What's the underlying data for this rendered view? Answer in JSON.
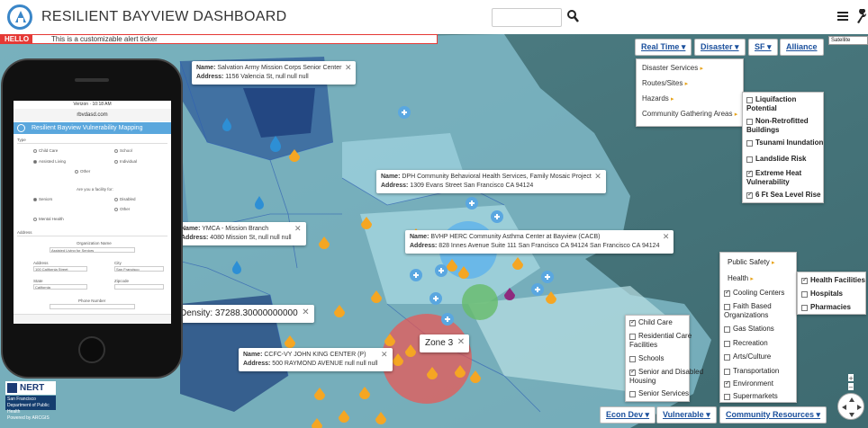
{
  "header": {
    "title": "RESILIENT BAYVIEW DASHBOARD",
    "search_placeholder": ""
  },
  "icons": {
    "logo": "logo-icon",
    "search": "search-icon",
    "menu": "menu-icon",
    "tools": "wrench-icon",
    "marker_water": "water-drop-icon",
    "marker_health": "health-cross-icon",
    "marker_people": "people-icon"
  },
  "colors": {
    "ticker_red": "#e53935",
    "link_blue": "#1a4f9c",
    "zone_red": "#ef5350",
    "buffer_green": "#66bb6a",
    "buffer_blue": "#42a5f5",
    "marker_orange": "#f5a623",
    "marker_blue": "#2d8fd5",
    "marker_purple": "#8e2a7e",
    "choropleth_dark": "#1b3d7a"
  },
  "ticker": {
    "label": "HELLO",
    "text": "This is a customizable alert ticker"
  },
  "popups": [
    {
      "name_label": "Name:",
      "name": "Salvation Army Mission Corps Senior Center",
      "address_label": "Address:",
      "address": "1156 Valencia St, null null null"
    },
    {
      "name_label": "Name:",
      "name": "DPH Community Behavioral Health Services, Family Mosaic Project",
      "address_label": "Address:",
      "address": "1309 Evans Street San Francisco CA 94124"
    },
    {
      "name_label": "Name:",
      "name": "YMCA - Mission Branch",
      "address_label": "Address:",
      "address": "4080 Mission St, null null null"
    },
    {
      "name_label": "Name:",
      "name": "BVHP HERC Community Asthma Center at Bayview (CACB)",
      "address_label": "Address:",
      "address": "828 Innes Avenue Suite 111 San Francisco CA 94124 San Francisco CA 94124"
    },
    {
      "name_label": "Name:",
      "name": "CCFC-VY JOHN KING CENTER (P)",
      "address_label": "Address:",
      "address": "500 RAYMOND AVENUE null null null"
    }
  ],
  "density_popup": {
    "text": "Density: 37288.30000000000"
  },
  "zone_popup": {
    "text": "Zone 3"
  },
  "map_buttons": {
    "real_time": "Real Time",
    "disaster": "Disaster",
    "sf": "SF",
    "alliance": "Alliance",
    "satellite": "Satellite",
    "econ_dev": "Econ Dev",
    "vulnerable": "Vulnerable",
    "community_resources": "Community Resources"
  },
  "disaster_menu": {
    "items": [
      "Disaster Services",
      "Routes/Sites",
      "Hazards",
      "Community Gathering Areas"
    ]
  },
  "hazard_layers": [
    {
      "label": "Liquifaction",
      "label2": "Potential",
      "checked": false
    },
    {
      "label": "Non-Retrofitted",
      "label2": "Buildings",
      "checked": false
    },
    {
      "label": "Tsunami Inundation",
      "checked": false
    },
    {
      "label": "Landslide Risk",
      "checked": false
    },
    {
      "label": "Extreme Heat",
      "label2": "Vulnerability",
      "checked": true
    },
    {
      "label": "6 Ft Sea Level Rise",
      "checked": true
    }
  ],
  "community_menu": {
    "items": [
      {
        "label": "Public Safety",
        "checked": null
      },
      {
        "label": "Health",
        "checked": null
      },
      {
        "label": "Cooling Centers",
        "checked": true
      },
      {
        "label": "Faith Based",
        "label2": "Organizations",
        "checked": false
      },
      {
        "label": "Gas Stations",
        "checked": false
      },
      {
        "label": "Recreation",
        "checked": false
      },
      {
        "label": "Arts/Culture",
        "checked": false
      },
      {
        "label": "Transportation",
        "checked": false
      },
      {
        "label": "Environment",
        "checked": true
      },
      {
        "label": "Supermarkets",
        "checked": false
      }
    ]
  },
  "health_menu": {
    "items": [
      {
        "label": "Health Facilities",
        "checked": true
      },
      {
        "label": "Hospitals",
        "checked": false
      },
      {
        "label": "Pharmacies",
        "checked": false
      }
    ]
  },
  "vulnerable_menu": {
    "items": [
      {
        "label": "Child Care",
        "checked": true
      },
      {
        "label": "Residential Care",
        "label2": "Facilities",
        "checked": false
      },
      {
        "label": "Schools",
        "checked": false
      },
      {
        "label": "Senior and Disabled",
        "label2": "Housing",
        "checked": true
      },
      {
        "label": "Senior Services",
        "checked": false
      }
    ]
  },
  "phone": {
    "status": "Verizon",
    "time": "10:18 AM",
    "url": "rbvdasd.com",
    "app_title": "Resilient Bayview Vulnerability Mapping",
    "section_type": "Type",
    "type_options": [
      "Child Care",
      "School",
      "Assisted Living",
      "Individual",
      "Other"
    ],
    "question": "Are you a facility for:",
    "facility_options": [
      "Seniors",
      "Disabled",
      "Other",
      "Mental Health"
    ],
    "section_address": "Address",
    "org_name_label": "Organization Name",
    "org_name_value": "Assisted Living for Seniors",
    "address_label": "Address",
    "address_value": "100 California Street",
    "city_label": "City",
    "city_value": "San Francisco",
    "state_label": "State",
    "state_value": "California",
    "zip_label": "Zipcode",
    "phone_label": "Phone Number"
  },
  "branding": {
    "nert": "NERT",
    "sf_badge_line1": "San Francisco",
    "sf_badge_line2": "Department of Public Health",
    "sf_badge_line3": "Powered by ARCGIS"
  }
}
